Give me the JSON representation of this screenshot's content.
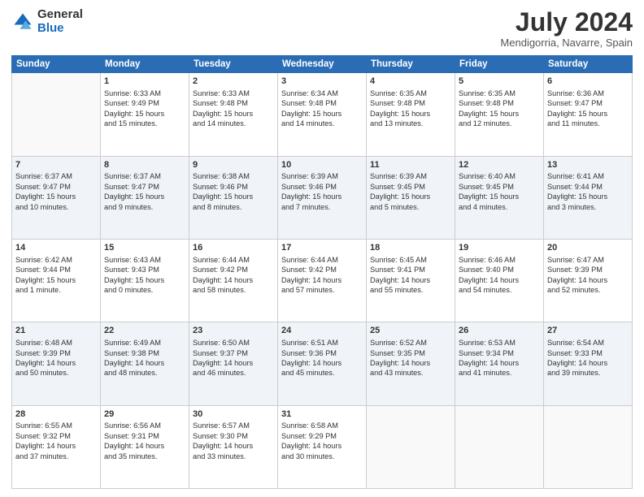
{
  "header": {
    "logo_general": "General",
    "logo_blue": "Blue",
    "month": "July 2024",
    "location": "Mendigorria, Navarre, Spain"
  },
  "weekdays": [
    "Sunday",
    "Monday",
    "Tuesday",
    "Wednesday",
    "Thursday",
    "Friday",
    "Saturday"
  ],
  "weeks": [
    [
      {
        "day": "",
        "info": ""
      },
      {
        "day": "1",
        "info": "Sunrise: 6:33 AM\nSunset: 9:49 PM\nDaylight: 15 hours\nand 15 minutes."
      },
      {
        "day": "2",
        "info": "Sunrise: 6:33 AM\nSunset: 9:48 PM\nDaylight: 15 hours\nand 14 minutes."
      },
      {
        "day": "3",
        "info": "Sunrise: 6:34 AM\nSunset: 9:48 PM\nDaylight: 15 hours\nand 14 minutes."
      },
      {
        "day": "4",
        "info": "Sunrise: 6:35 AM\nSunset: 9:48 PM\nDaylight: 15 hours\nand 13 minutes."
      },
      {
        "day": "5",
        "info": "Sunrise: 6:35 AM\nSunset: 9:48 PM\nDaylight: 15 hours\nand 12 minutes."
      },
      {
        "day": "6",
        "info": "Sunrise: 6:36 AM\nSunset: 9:47 PM\nDaylight: 15 hours\nand 11 minutes."
      }
    ],
    [
      {
        "day": "7",
        "info": "Sunrise: 6:37 AM\nSunset: 9:47 PM\nDaylight: 15 hours\nand 10 minutes."
      },
      {
        "day": "8",
        "info": "Sunrise: 6:37 AM\nSunset: 9:47 PM\nDaylight: 15 hours\nand 9 minutes."
      },
      {
        "day": "9",
        "info": "Sunrise: 6:38 AM\nSunset: 9:46 PM\nDaylight: 15 hours\nand 8 minutes."
      },
      {
        "day": "10",
        "info": "Sunrise: 6:39 AM\nSunset: 9:46 PM\nDaylight: 15 hours\nand 7 minutes."
      },
      {
        "day": "11",
        "info": "Sunrise: 6:39 AM\nSunset: 9:45 PM\nDaylight: 15 hours\nand 5 minutes."
      },
      {
        "day": "12",
        "info": "Sunrise: 6:40 AM\nSunset: 9:45 PM\nDaylight: 15 hours\nand 4 minutes."
      },
      {
        "day": "13",
        "info": "Sunrise: 6:41 AM\nSunset: 9:44 PM\nDaylight: 15 hours\nand 3 minutes."
      }
    ],
    [
      {
        "day": "14",
        "info": "Sunrise: 6:42 AM\nSunset: 9:44 PM\nDaylight: 15 hours\nand 1 minute."
      },
      {
        "day": "15",
        "info": "Sunrise: 6:43 AM\nSunset: 9:43 PM\nDaylight: 15 hours\nand 0 minutes."
      },
      {
        "day": "16",
        "info": "Sunrise: 6:44 AM\nSunset: 9:42 PM\nDaylight: 14 hours\nand 58 minutes."
      },
      {
        "day": "17",
        "info": "Sunrise: 6:44 AM\nSunset: 9:42 PM\nDaylight: 14 hours\nand 57 minutes."
      },
      {
        "day": "18",
        "info": "Sunrise: 6:45 AM\nSunset: 9:41 PM\nDaylight: 14 hours\nand 55 minutes."
      },
      {
        "day": "19",
        "info": "Sunrise: 6:46 AM\nSunset: 9:40 PM\nDaylight: 14 hours\nand 54 minutes."
      },
      {
        "day": "20",
        "info": "Sunrise: 6:47 AM\nSunset: 9:39 PM\nDaylight: 14 hours\nand 52 minutes."
      }
    ],
    [
      {
        "day": "21",
        "info": "Sunrise: 6:48 AM\nSunset: 9:39 PM\nDaylight: 14 hours\nand 50 minutes."
      },
      {
        "day": "22",
        "info": "Sunrise: 6:49 AM\nSunset: 9:38 PM\nDaylight: 14 hours\nand 48 minutes."
      },
      {
        "day": "23",
        "info": "Sunrise: 6:50 AM\nSunset: 9:37 PM\nDaylight: 14 hours\nand 46 minutes."
      },
      {
        "day": "24",
        "info": "Sunrise: 6:51 AM\nSunset: 9:36 PM\nDaylight: 14 hours\nand 45 minutes."
      },
      {
        "day": "25",
        "info": "Sunrise: 6:52 AM\nSunset: 9:35 PM\nDaylight: 14 hours\nand 43 minutes."
      },
      {
        "day": "26",
        "info": "Sunrise: 6:53 AM\nSunset: 9:34 PM\nDaylight: 14 hours\nand 41 minutes."
      },
      {
        "day": "27",
        "info": "Sunrise: 6:54 AM\nSunset: 9:33 PM\nDaylight: 14 hours\nand 39 minutes."
      }
    ],
    [
      {
        "day": "28",
        "info": "Sunrise: 6:55 AM\nSunset: 9:32 PM\nDaylight: 14 hours\nand 37 minutes."
      },
      {
        "day": "29",
        "info": "Sunrise: 6:56 AM\nSunset: 9:31 PM\nDaylight: 14 hours\nand 35 minutes."
      },
      {
        "day": "30",
        "info": "Sunrise: 6:57 AM\nSunset: 9:30 PM\nDaylight: 14 hours\nand 33 minutes."
      },
      {
        "day": "31",
        "info": "Sunrise: 6:58 AM\nSunset: 9:29 PM\nDaylight: 14 hours\nand 30 minutes."
      },
      {
        "day": "",
        "info": ""
      },
      {
        "day": "",
        "info": ""
      },
      {
        "day": "",
        "info": ""
      }
    ]
  ]
}
